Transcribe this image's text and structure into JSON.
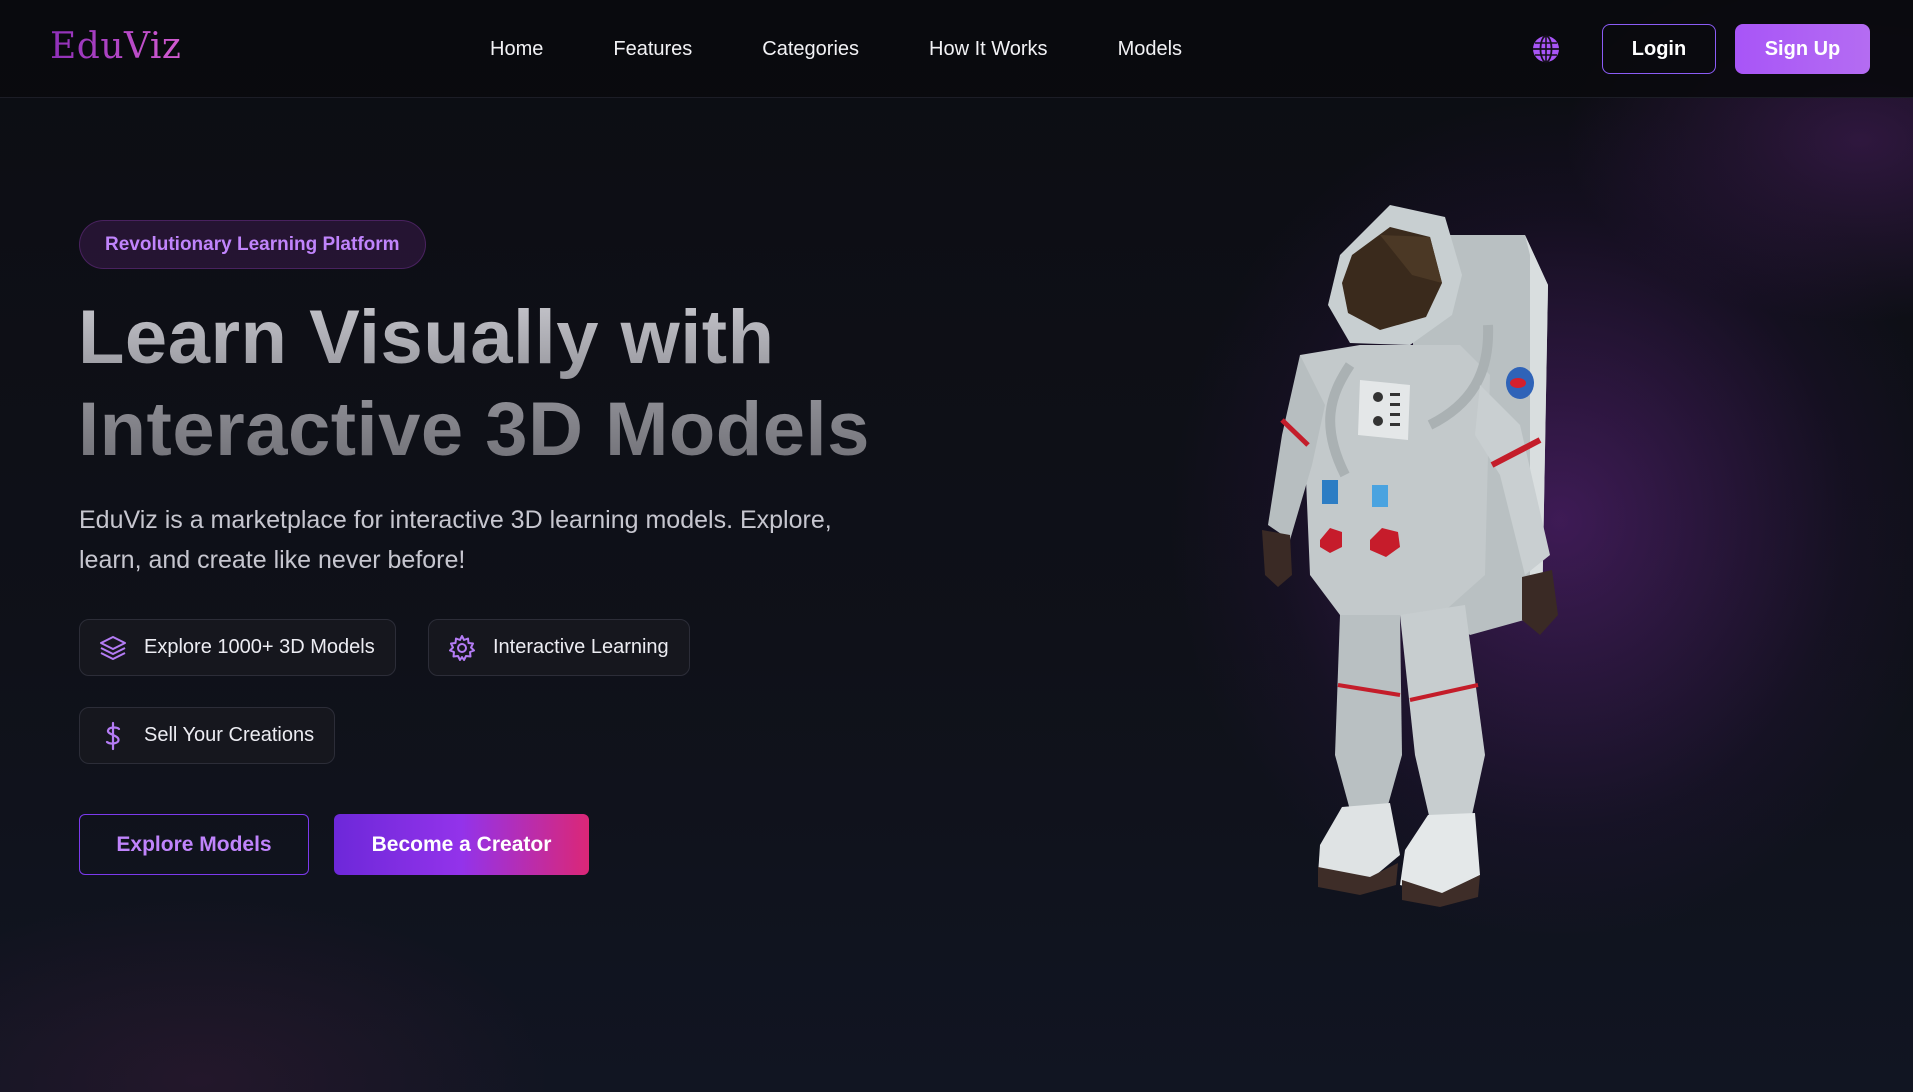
{
  "brand": {
    "logo_text": "EduViz"
  },
  "nav": {
    "links": [
      "Home",
      "Features",
      "Categories",
      "How It Works",
      "Models"
    ],
    "login_label": "Login",
    "signup_label": "Sign Up",
    "language_icon": "globe-icon"
  },
  "hero": {
    "badge": "Revolutionary Learning Platform",
    "headline_line1": "Learn Visually with",
    "headline_line2": "Interactive 3D Models",
    "subtext": "EduViz is a marketplace for interactive 3D learning models. Explore, learn, and create like never before!",
    "features": [
      {
        "label": "Explore 1000+ 3D Models",
        "icon": "layers-icon"
      },
      {
        "label": "Interactive Learning",
        "icon": "gear-icon"
      },
      {
        "label": "Sell Your Creations",
        "icon": "dollar-icon"
      }
    ],
    "primary_cta": "Explore Models",
    "secondary_cta": "Become a Creator"
  },
  "colors": {
    "accent": "#a855f7",
    "accent_light": "#c084fc",
    "brand_gradient_end": "#db2777",
    "background": "#0d0e14"
  }
}
